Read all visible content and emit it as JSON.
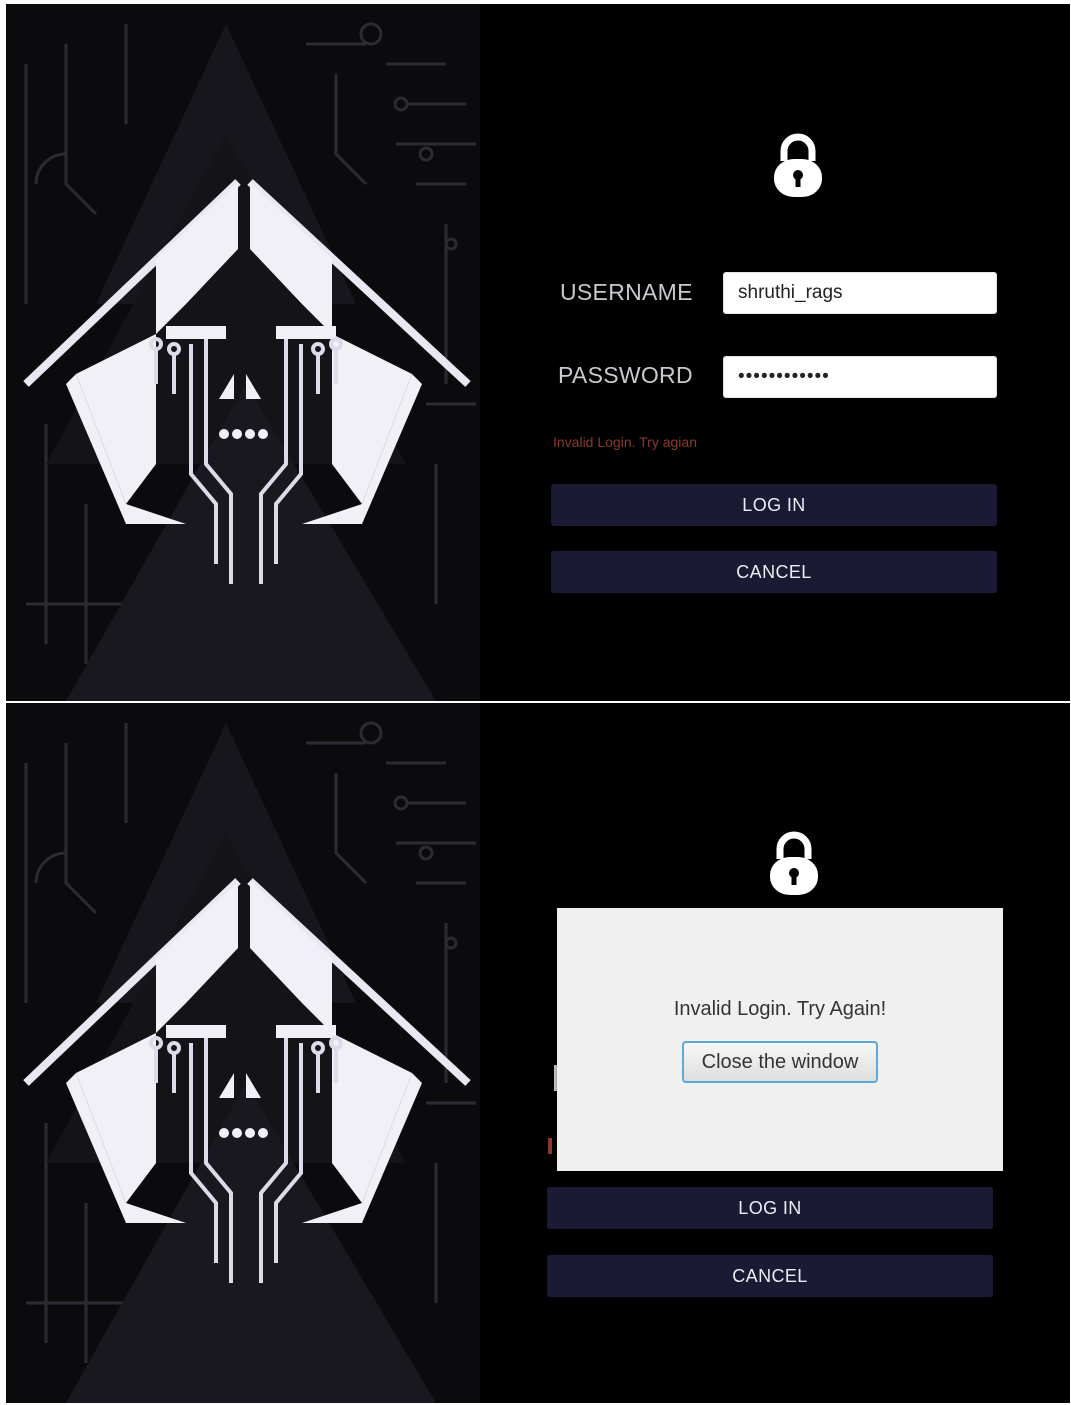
{
  "screen1": {
    "username_label": "USERNAME",
    "password_label": "PASSWORD",
    "username_value": "shruthi_rags",
    "password_value": "••••••••••••",
    "error_text": "Invalid Login. Try agian",
    "login_label": "LOG IN",
    "cancel_label": "CANCEL"
  },
  "screen2": {
    "dialog_message": "Invalid Login. Try Again!",
    "dialog_button": "Close the window",
    "login_label": "LOG IN",
    "cancel_label": "CANCEL"
  },
  "icons": {
    "lock": "lock-icon",
    "logo": "circuit-hood-logo"
  },
  "colors": {
    "background": "#000000",
    "button": "#1b1a35",
    "error": "#8a3a2a",
    "dialog": "#f0f0f0",
    "dialog_button_border": "#5aa9d6"
  }
}
